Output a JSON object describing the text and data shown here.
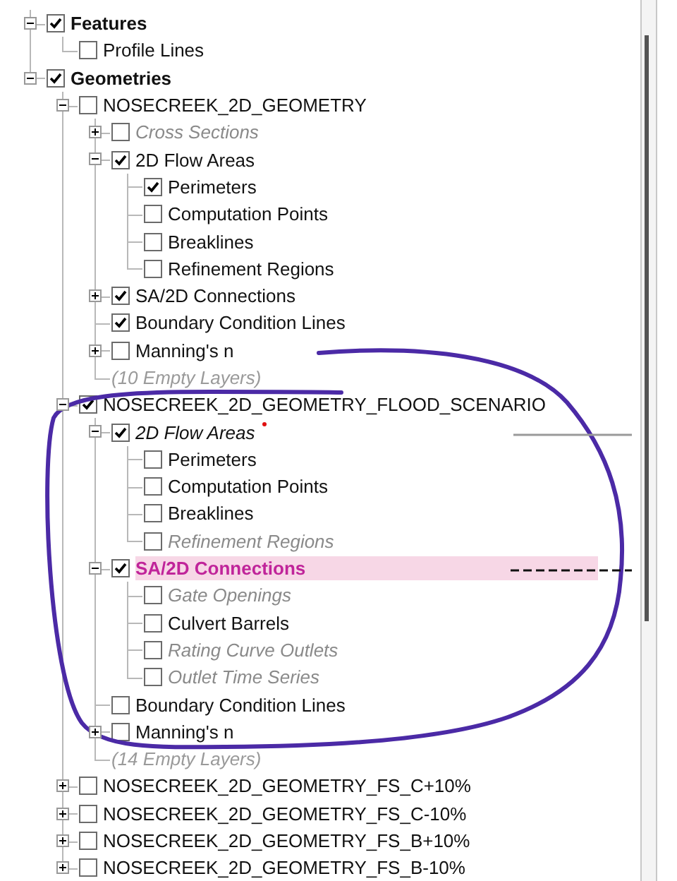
{
  "tree": [
    {
      "kind": "category",
      "label": "Features",
      "checked": true,
      "expanded": true,
      "children": [
        {
          "kind": "layer",
          "label": "Profile Lines",
          "checked": false
        }
      ]
    },
    {
      "kind": "category",
      "label": "Geometries",
      "checked": true,
      "expanded": true,
      "children": [
        {
          "kind": "layer",
          "label": "NOSECREEK_2D_GEOMETRY",
          "checked": false,
          "expanded": true,
          "children": [
            {
              "kind": "layer",
              "label": "Cross Sections",
              "checked": false,
              "expanded": false,
              "disabled": true
            },
            {
              "kind": "layer",
              "label": "2D Flow Areas",
              "checked": true,
              "expanded": true,
              "children": [
                {
                  "kind": "layer",
                  "label": "Perimeters",
                  "checked": true
                },
                {
                  "kind": "layer",
                  "label": "Computation Points",
                  "checked": false
                },
                {
                  "kind": "layer",
                  "label": "Breaklines",
                  "checked": false
                },
                {
                  "kind": "layer",
                  "label": "Refinement Regions",
                  "checked": false
                }
              ]
            },
            {
              "kind": "layer",
              "label": "SA/2D Connections",
              "checked": true,
              "expanded": false
            },
            {
              "kind": "layer",
              "label": "Boundary Condition Lines",
              "checked": true
            },
            {
              "kind": "layer",
              "label": "Manning's n",
              "checked": false,
              "expanded": false
            },
            {
              "kind": "note",
              "label": "(10 Empty Layers)"
            }
          ]
        },
        {
          "kind": "layer",
          "label": "NOSECREEK_2D_GEOMETRY_FLOOD_SCENARIO",
          "checked": true,
          "expanded": true,
          "children": [
            {
              "kind": "layer",
              "label": "2D Flow Areas",
              "checked": true,
              "expanded": true,
              "modified": true,
              "children": [
                {
                  "kind": "layer",
                  "label": "Perimeters",
                  "checked": false
                },
                {
                  "kind": "layer",
                  "label": "Computation Points",
                  "checked": false
                },
                {
                  "kind": "layer",
                  "label": "Breaklines",
                  "checked": false
                },
                {
                  "kind": "layer",
                  "label": "Refinement Regions",
                  "checked": false,
                  "disabled": true
                }
              ]
            },
            {
              "kind": "layer",
              "label": "SA/2D Connections",
              "checked": true,
              "expanded": true,
              "selected": true,
              "children": [
                {
                  "kind": "layer",
                  "label": "Gate Openings",
                  "checked": false,
                  "disabled": true
                },
                {
                  "kind": "layer",
                  "label": "Culvert Barrels",
                  "checked": false
                },
                {
                  "kind": "layer",
                  "label": "Rating Curve Outlets",
                  "checked": false,
                  "disabled": true
                },
                {
                  "kind": "layer",
                  "label": "Outlet Time Series",
                  "checked": false,
                  "disabled": true
                }
              ]
            },
            {
              "kind": "layer",
              "label": "Boundary Condition Lines",
              "checked": false
            },
            {
              "kind": "layer",
              "label": "Manning's n",
              "checked": false,
              "expanded": false
            },
            {
              "kind": "note",
              "label": "(14 Empty Layers)"
            }
          ]
        },
        {
          "kind": "layer",
          "label": "NOSECREEK_2D_GEOMETRY_FS_C+10%",
          "checked": false,
          "expanded": false
        },
        {
          "kind": "layer",
          "label": "NOSECREEK_2D_GEOMETRY_FS_C-10%",
          "checked": false,
          "expanded": false
        },
        {
          "kind": "layer",
          "label": "NOSECREEK_2D_GEOMETRY_FS_B+10%",
          "checked": false,
          "expanded": false
        },
        {
          "kind": "layer",
          "label": "NOSECREEK_2D_GEOMETRY_FS_B-10%",
          "checked": false,
          "expanded": false
        }
      ]
    }
  ]
}
